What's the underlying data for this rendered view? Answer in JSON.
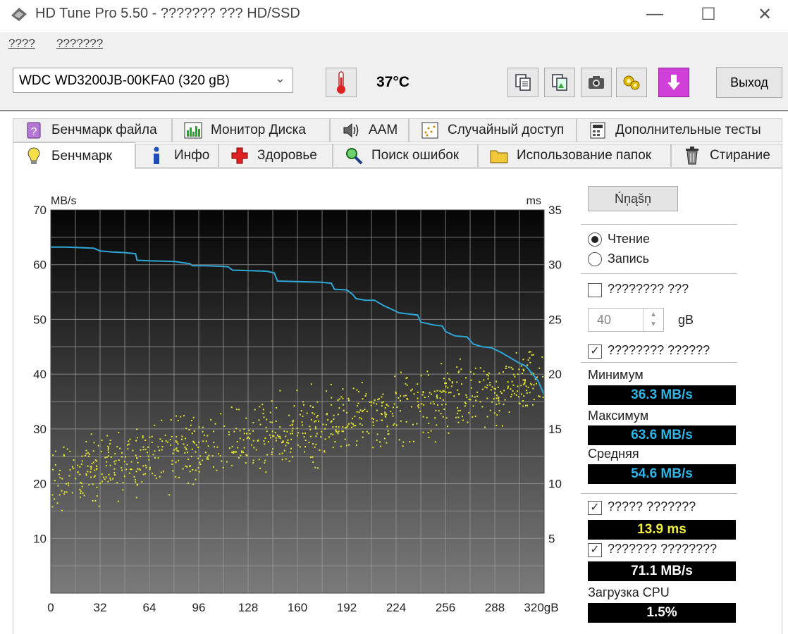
{
  "window": {
    "title": "HD Tune Pro 5.50 - ??????? ??? HD/SSD",
    "minimize": "—",
    "maximize": "☐",
    "close": "✕"
  },
  "menu": {
    "items": [
      "????",
      "???????"
    ]
  },
  "toolbar": {
    "drive": "WDC WD3200JB-00KFA0 (320 gB)",
    "temperature": "37°C",
    "exit_label": "Выход"
  },
  "tabs": {
    "row1": [
      "Бенчмарк файла",
      "Монитор Диска",
      "AAM",
      "Случайный доступ",
      "Дополнительные тесты"
    ],
    "row2": [
      "Бенчмарк",
      "Инфо",
      "Здоровье",
      "Поиск ошибок",
      "Использование папок",
      "Стирание"
    ]
  },
  "chart_data": {
    "type": "line",
    "y_left_label": "MB/s",
    "y_right_label": "ms",
    "ylim_left": [
      0,
      70
    ],
    "ylim_right": [
      0,
      35
    ],
    "xlim": [
      0,
      320
    ],
    "x_ticks": [
      "0",
      "32",
      "64",
      "96",
      "128",
      "160",
      "192",
      "224",
      "256",
      "288",
      "320gB"
    ],
    "y_left_ticks": [
      "70",
      "60",
      "50",
      "40",
      "30",
      "20",
      "10"
    ],
    "y_right_ticks": [
      "35",
      "30",
      "25",
      "20",
      "15",
      "10",
      "5"
    ],
    "grid": true,
    "series": [
      {
        "name": "transfer",
        "color": "#2ea7d8",
        "x": [
          0,
          10,
          20,
          28,
          32,
          40,
          48,
          55,
          56,
          64,
          80,
          90,
          92,
          100,
          110,
          115,
          118,
          130,
          140,
          145,
          147,
          160,
          175,
          182,
          184,
          192,
          196,
          198,
          204,
          210,
          216,
          220,
          226,
          232,
          238,
          240,
          248,
          254,
          256,
          262,
          270,
          274,
          280,
          286,
          292,
          298,
          304,
          308,
          312,
          316,
          320
        ],
        "values": [
          63.2,
          63.2,
          63.1,
          63.0,
          62.5,
          62.3,
          62.2,
          62.0,
          60.8,
          60.7,
          60.6,
          60.2,
          59.8,
          59.8,
          59.7,
          59.6,
          59.0,
          58.9,
          58.8,
          58.5,
          57.0,
          56.9,
          56.8,
          56.6,
          55.5,
          55.4,
          54.5,
          53.8,
          53.5,
          53.5,
          52.5,
          52.0,
          51.2,
          51.0,
          50.8,
          49.5,
          49.0,
          48.8,
          47.8,
          47.0,
          46.8,
          45.5,
          45.0,
          44.8,
          44.0,
          43.0,
          42.0,
          41.5,
          40.2,
          38.8,
          36.3
        ]
      },
      {
        "name": "access time",
        "color": "#e6e62c",
        "type": "scatter",
        "trend_ms": {
          "start": 10.5,
          "end": 19.5
        },
        "spread_ms": 2.5
      }
    ]
  },
  "controls": {
    "start_label": "Ńņąšņ",
    "read_label": "Чтение",
    "write_label": "Запись",
    "short_stroke_label": "???????? ???",
    "short_stroke_value": "40",
    "short_stroke_unit": "gB",
    "transfer_rate_label": "???????? ??????"
  },
  "stats": {
    "min_label": "Минимум",
    "min_value": "36.3 MB/s",
    "max_label": "Максимум",
    "max_value": "63.6 MB/s",
    "avg_label": "Средняя",
    "avg_value": "54.6 MB/s",
    "access_label": "????? ???????",
    "access_value": "13.9 ms",
    "burst_label": "??????? ????????",
    "burst_value": "71.1 MB/s",
    "cpu_label": "Загрузка CPU",
    "cpu_value": "1.5%"
  },
  "colors": {
    "stat_value_blue": "#2fb6e8",
    "stat_value_yellow": "#f2f23a",
    "stat_value_white": "#ffffff"
  }
}
